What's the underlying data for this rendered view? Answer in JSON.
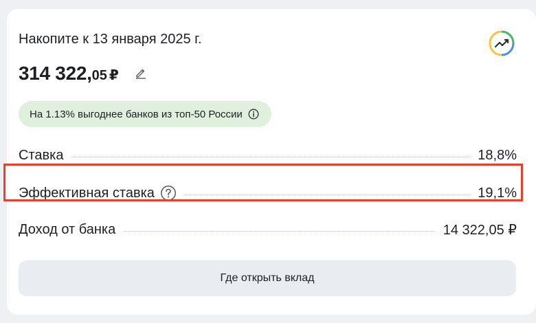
{
  "card": {
    "title": "Накопите к 13 января 2025 г.",
    "amount": {
      "main": "314 322,",
      "cents": "05",
      "currency": "₽"
    },
    "badge_text": "На 1.13% выгоднее банков из топ-50 России",
    "rows": [
      {
        "label": "Ставка",
        "value": "18,8%"
      },
      {
        "label": "Эффективная ставка",
        "value": "19,1%"
      },
      {
        "label": "Доход от банка",
        "value": "14 322,05 ₽"
      }
    ],
    "button_label": "Где открыть вклад"
  },
  "colors": {
    "highlight_border": "#e4422a",
    "badge_background": "#dff0dc",
    "button_background": "#e9ecf0"
  },
  "icons": {
    "edit": "pencil-icon",
    "info": "info-icon",
    "question": "question-circle-icon",
    "chart": "growth-chart-icon"
  }
}
